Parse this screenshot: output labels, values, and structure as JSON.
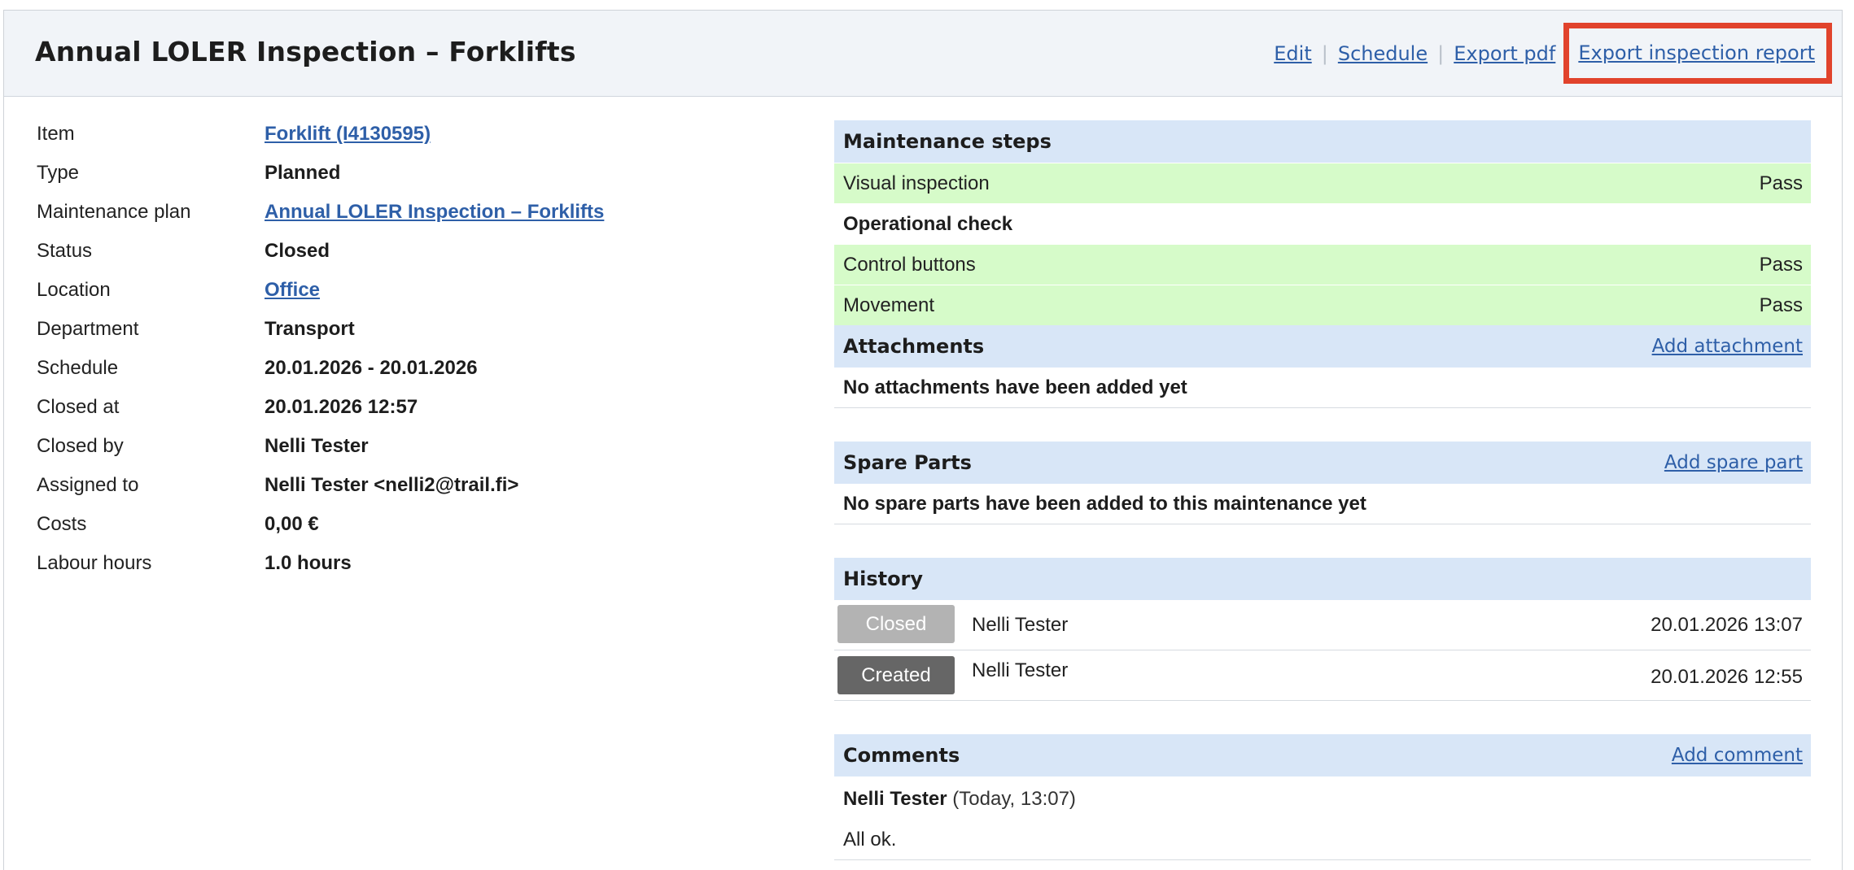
{
  "header": {
    "title": "Annual LOLER Inspection – Forklifts",
    "actions": {
      "edit": "Edit",
      "schedule": "Schedule",
      "export_pdf": "Export pdf",
      "export_report": "Export inspection report"
    },
    "highlight_color": "#e1432c"
  },
  "details": [
    {
      "label": "Item",
      "value": "Forklift (I4130595)",
      "link": true
    },
    {
      "label": "Type",
      "value": "Planned",
      "link": false
    },
    {
      "label": "Maintenance plan",
      "value": "Annual LOLER Inspection – Forklifts",
      "link": true
    },
    {
      "label": "Status",
      "value": "Closed",
      "link": false
    },
    {
      "label": "Location",
      "value": "Office",
      "link": true
    },
    {
      "label": "Department",
      "value": "Transport",
      "link": false
    },
    {
      "label": "Schedule",
      "value": "20.01.2026 - 20.01.2026",
      "link": false
    },
    {
      "label": "Closed at",
      "value": "20.01.2026 12:57",
      "link": false
    },
    {
      "label": "Closed by",
      "value": "Nelli Tester",
      "link": false
    },
    {
      "label": "Assigned to",
      "value": "Nelli Tester <nelli2@trail.fi>",
      "link": false
    },
    {
      "label": "Costs",
      "value": "0,00 €",
      "link": false
    },
    {
      "label": "Labour hours",
      "value": "1.0 hours",
      "link": false
    }
  ],
  "maintenance_steps": {
    "heading": "Maintenance steps",
    "steps": [
      {
        "label": "Visual inspection",
        "result": "Pass",
        "type": "check"
      },
      {
        "label": "Operational check",
        "result": "",
        "type": "group"
      },
      {
        "label": "Control buttons",
        "result": "Pass",
        "type": "check"
      },
      {
        "label": "Movement",
        "result": "Pass",
        "type": "check"
      }
    ]
  },
  "attachments": {
    "heading": "Attachments",
    "add_label": "Add attachment",
    "empty_text": "No attachments have been added yet"
  },
  "spare_parts": {
    "heading": "Spare Parts",
    "add_label": "Add spare part",
    "empty_text": "No spare parts have been added to this maintenance yet"
  },
  "history": {
    "heading": "History",
    "entries": [
      {
        "badge": "Closed",
        "badge_color": "#b3b3b3",
        "user": "Nelli Tester",
        "time": "20.01.2026 13:07"
      },
      {
        "badge": "Created",
        "badge_color": "#666666",
        "user": "Nelli Tester",
        "time": "20.01.2026 12:55"
      }
    ]
  },
  "comments": {
    "heading": "Comments",
    "add_label": "Add comment",
    "items": [
      {
        "author": "Nelli Tester",
        "time": "(Today, 13:07)",
        "text": "All ok."
      }
    ]
  }
}
